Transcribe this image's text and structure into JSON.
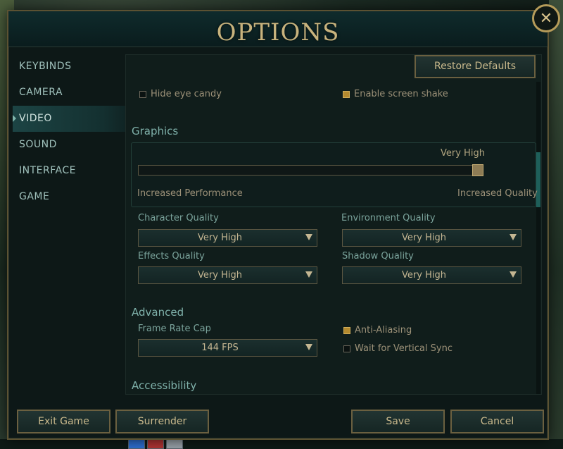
{
  "window": {
    "title": "OPTIONS"
  },
  "sidebar": {
    "items": [
      {
        "label": "KEYBINDS"
      },
      {
        "label": "CAMERA"
      },
      {
        "label": "VIDEO",
        "active": true
      },
      {
        "label": "SOUND"
      },
      {
        "label": "INTERFACE"
      },
      {
        "label": "GAME"
      }
    ]
  },
  "toolbar": {
    "restore_label": "Restore Defaults"
  },
  "top_options": {
    "hide_eye_candy": {
      "label": "Hide eye candy",
      "checked": false
    },
    "enable_screen_shake": {
      "label": "Enable screen shake",
      "checked": true
    }
  },
  "graphics": {
    "section_title": "Graphics",
    "preset_value": "Very High",
    "slider_level": 1.0,
    "left_label": "Increased Performance",
    "right_label": "Increased Quality",
    "character_quality": {
      "label": "Character Quality",
      "value": "Very High"
    },
    "environment_quality": {
      "label": "Environment Quality",
      "value": "Very High"
    },
    "effects_quality": {
      "label": "Effects Quality",
      "value": "Very High"
    },
    "shadow_quality": {
      "label": "Shadow Quality",
      "value": "Very High"
    }
  },
  "advanced": {
    "section_title": "Advanced",
    "frame_rate_cap": {
      "label": "Frame Rate Cap",
      "value": "144 FPS"
    },
    "anti_aliasing": {
      "label": "Anti-Aliasing",
      "checked": true
    },
    "vsync": {
      "label": "Wait for Vertical Sync",
      "checked": false
    }
  },
  "accessibility": {
    "section_title": "Accessibility"
  },
  "footer": {
    "exit_label": "Exit Game",
    "surrender_label": "Surrender",
    "save_label": "Save",
    "cancel_label": "Cancel"
  },
  "colors": {
    "gold": "#c8b37d",
    "teal": "#7fb1aa",
    "check": "#b48a2f"
  }
}
